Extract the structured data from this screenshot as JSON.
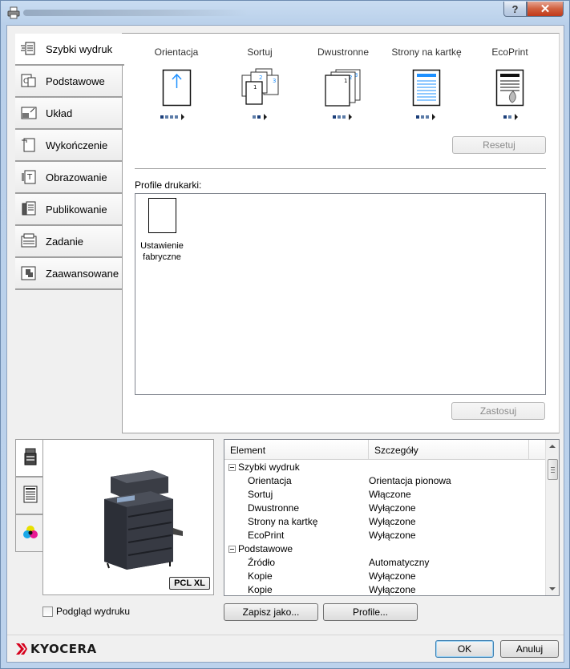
{
  "window": {
    "title": ""
  },
  "titlebar": {
    "help_label": "?",
    "close_label": "✕"
  },
  "colors": {
    "accent": "#1e90ff",
    "kyocera_red": "#d6001c",
    "tab_border": "#a0a0a0"
  },
  "side_tabs": [
    {
      "label": "Szybki wydruk",
      "icon": "quick-print-icon",
      "active": true
    },
    {
      "label": "Podstawowe",
      "icon": "basic-icon"
    },
    {
      "label": "Układ",
      "icon": "layout-icon"
    },
    {
      "label": "Wykończenie",
      "icon": "finishing-icon"
    },
    {
      "label": "Obrazowanie",
      "icon": "imaging-icon"
    },
    {
      "label": "Publikowanie",
      "icon": "publishing-icon"
    },
    {
      "label": "Zadanie",
      "icon": "job-icon"
    },
    {
      "label": "Zaawansowane",
      "icon": "advanced-icon"
    }
  ],
  "quick_options": [
    {
      "label": "Orientacja",
      "icon": "orientation-icon"
    },
    {
      "label": "Sortuj",
      "icon": "collate-icon"
    },
    {
      "label": "Dwustronne",
      "icon": "duplex-icon"
    },
    {
      "label": "Strony na kartkę",
      "icon": "pages-per-sheet-icon"
    },
    {
      "label": "EcoPrint",
      "icon": "ecoprint-icon"
    }
  ],
  "buttons": {
    "reset": "Resetuj",
    "apply": "Zastosuj",
    "save_as": "Zapisz jako...",
    "profiles": "Profile...",
    "ok": "OK",
    "cancel": "Anuluj"
  },
  "profiles": {
    "label": "Profile drukarki:",
    "items": [
      {
        "name_line1": "Ustawienie",
        "name_line2": "fabryczne"
      }
    ]
  },
  "preview": {
    "badge": "PCL XL",
    "checkbox_label": "Podgląd wydruku",
    "checkbox_checked": false,
    "tabs": [
      "printer-icon",
      "document-icon",
      "color-icon"
    ]
  },
  "summary": {
    "headers": [
      "Element",
      "Szczegóły"
    ],
    "rows": [
      {
        "type": "group",
        "element": "Szybki wydruk",
        "details": ""
      },
      {
        "type": "child",
        "element": "Orientacja",
        "details": "Orientacja pionowa"
      },
      {
        "type": "child",
        "element": "Sortuj",
        "details": "Włączone"
      },
      {
        "type": "child",
        "element": "Dwustronne",
        "details": "Wyłączone"
      },
      {
        "type": "child",
        "element": "Strony na kartkę",
        "details": "Wyłączone"
      },
      {
        "type": "child",
        "element": "EcoPrint",
        "details": "Wyłączone"
      },
      {
        "type": "group",
        "element": "Podstawowe",
        "details": ""
      },
      {
        "type": "child",
        "element": "Źródło",
        "details": "Automatyczny"
      },
      {
        "type": "child",
        "element": "Kopie",
        "details": "Wyłączone"
      },
      {
        "type": "child",
        "element": "Kopie",
        "details": "Wyłączone"
      }
    ]
  },
  "brand": {
    "logo_text": "KYOCERA"
  }
}
